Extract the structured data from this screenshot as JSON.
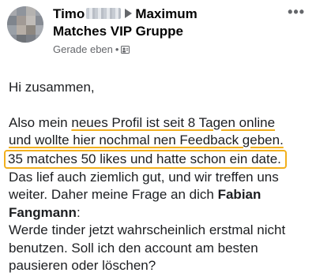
{
  "post": {
    "author_first": "Timo",
    "group_name_line1": "Maximum",
    "group_name_line2": "Matches VIP Gruppe",
    "timestamp": "Gerade eben",
    "dot": "•",
    "more_label": "•••",
    "icons": {
      "arrow": "triangle-right-icon",
      "audience": "group-members-icon",
      "more": "more-options-icon"
    }
  },
  "body": {
    "greeting": "Hi zusammen,",
    "line1_a": "Also mein ",
    "line1_b": "neues Profil ist seit 8 Tagen online",
    "line2": "und wollte hier nochmal nen Feedback geben.",
    "line3": "35 matches 50 likes und hatte schon ein date.",
    "line4": "Das lief auch ziemlich gut, und wir treffen uns",
    "line5_a": "weiter. Daher meine Frage an dich ",
    "line5_b": "Fabian",
    "line6_a": "Fangmann",
    "line6_b": ":",
    "line7": "Werde tinder jetzt wahrscheinlich erstmal nicht",
    "line8": "benutzen. Soll ich den account am besten",
    "line9": "pausieren oder löschen?"
  },
  "colors": {
    "highlight": "#f2b01e",
    "meta": "#65676b",
    "text": "#1c1e21"
  }
}
